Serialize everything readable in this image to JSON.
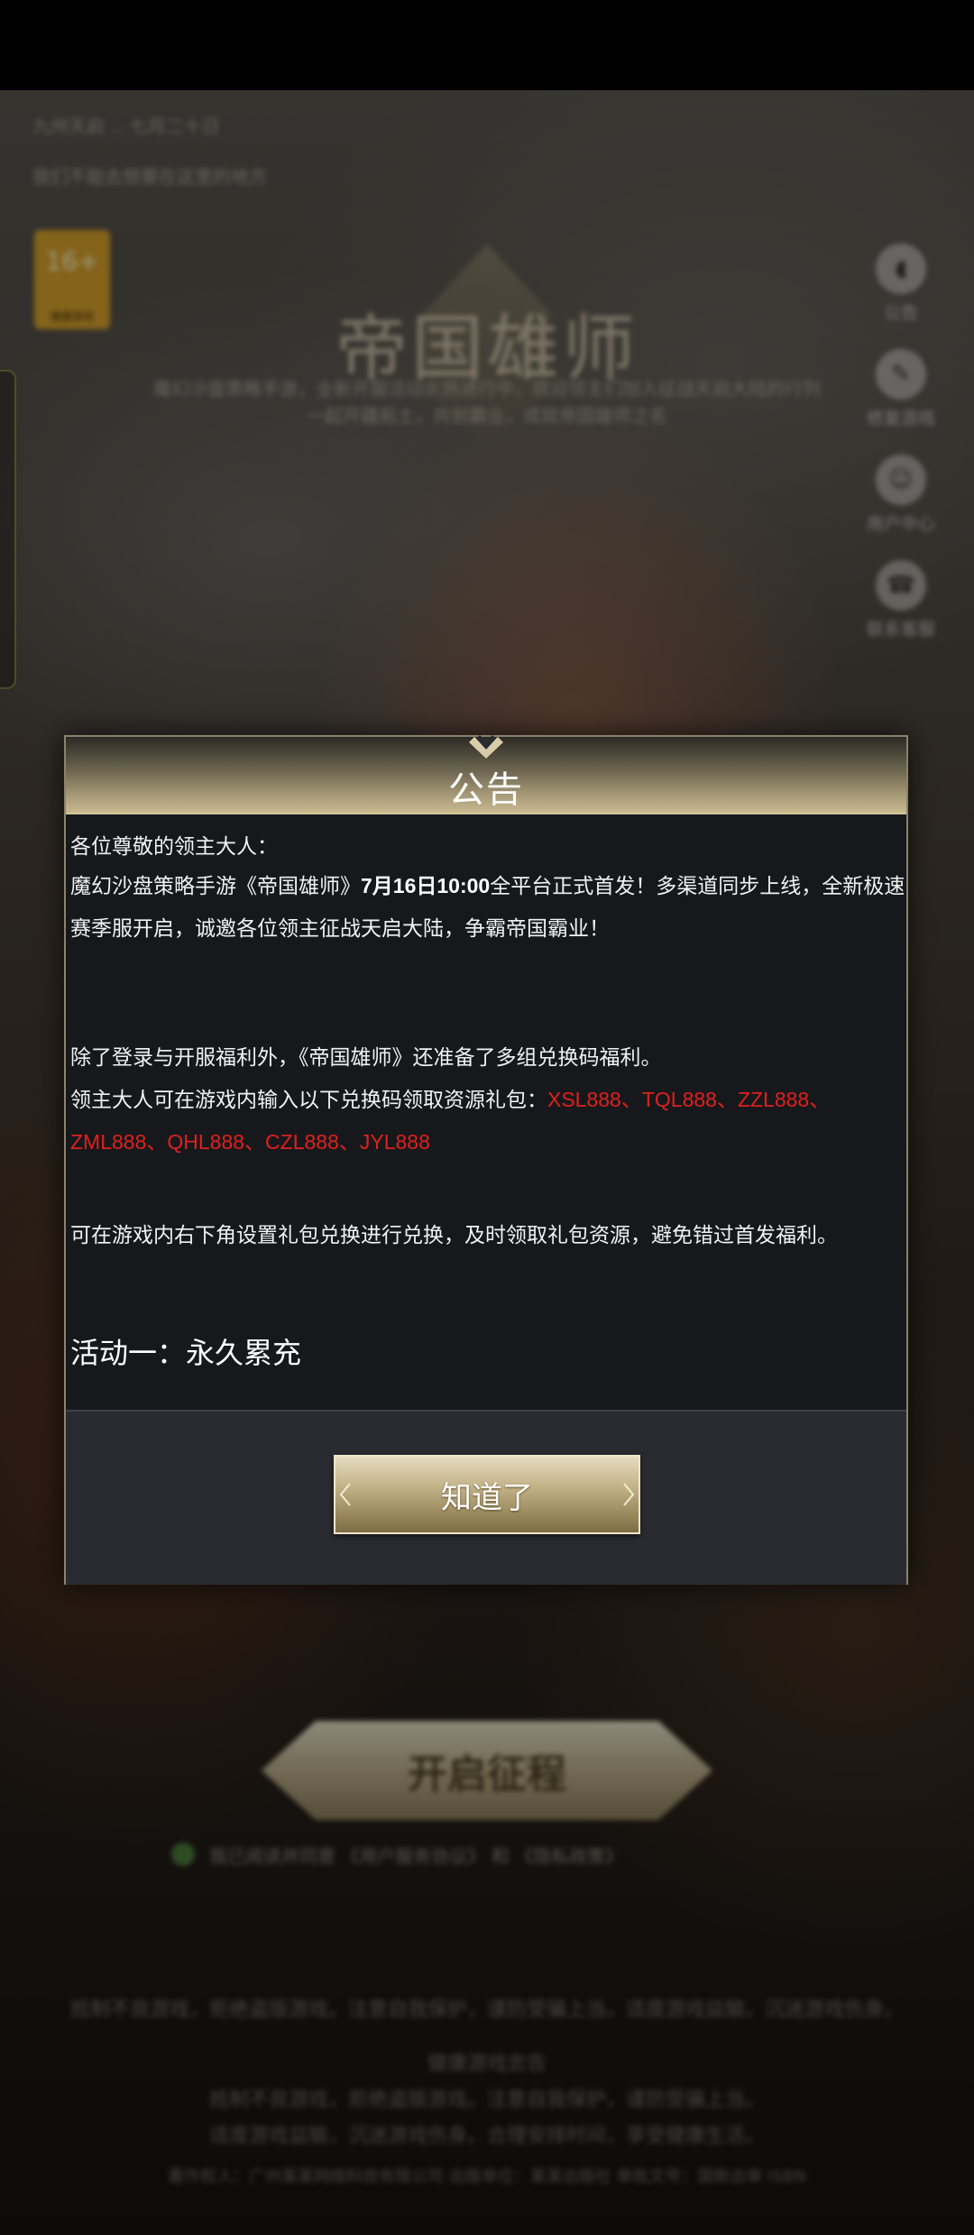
{
  "background": {
    "top_line_1": "九州天启 ... 七月二十日",
    "top_line_2": "我们不能去想要在这里的地方",
    "game_icon_caption": "健康游戏",
    "game_icon_glyph": "16+",
    "logo_title": "帝国雄师",
    "tagline_1": "魔幻沙盘策略手游，全新开服活动火热进行中，欢迎领主们加入征战天启大陆的行列",
    "tagline_2": "一起开疆拓土，共创霸业，成就帝国雄师之名",
    "right_menu": [
      {
        "label": "公告",
        "icon": "speaker-icon"
      },
      {
        "label": "修复游戏",
        "icon": "wrench-icon"
      },
      {
        "label": "用户中心",
        "icon": "user-icon"
      },
      {
        "label": "联系客服",
        "icon": "headset-icon"
      }
    ],
    "start_button": "开启征程",
    "agree_text": "我已阅读并同意 《用户服务协议》 和 《隐私政策》",
    "footer_lines": [
      "抵制不良游戏，拒绝盗版游戏。注意自我保护，谨防受骗上当。适度游戏益脑，沉迷游戏伤身。",
      "健康游戏忠告",
      "抵制不良游戏，拒绝盗版游戏。注意自我保护，谨防受骗上当。",
      "适度游戏益脑，沉迷游戏伤身。合理安排时间，享受健康生活。",
      "著作权人：广州某某网络科技有限公司 出版单位：某某出版社 审批文号：国新出审 ISBN"
    ]
  },
  "dialog": {
    "title": "公告",
    "greeting": "各位尊敬的领主大人：",
    "para1_pre": "魔幻沙盘策略手游《帝国雄师》",
    "para1_bold": "7月16日10:00",
    "para1_post": "全平台正式首发！多渠道同步上线，全新极速赛季服开启，诚邀各位领主征战天启大陆，争霸帝国霸业！",
    "para2": "除了登录与开服福利外，《帝国雄师》还准备了多组兑换码福利。",
    "para3_pre": "领主大人可在游戏内输入以下兑换码领取资源礼包：",
    "para3_codes": "XSL888、TQL888、ZZL888、ZML888、QHL888、CZL888、JYL888",
    "para4": "可在游戏内右下角设置礼包兑换进行兑换，及时领取礼包资源，避免错过首发福利。",
    "activity_heading": "活动一：永久累充",
    "ok_button": "知道了"
  },
  "colors": {
    "code_red": "#e0201c",
    "dialog_body_bg": "#17181c",
    "gold_border": "#d4c49a"
  }
}
